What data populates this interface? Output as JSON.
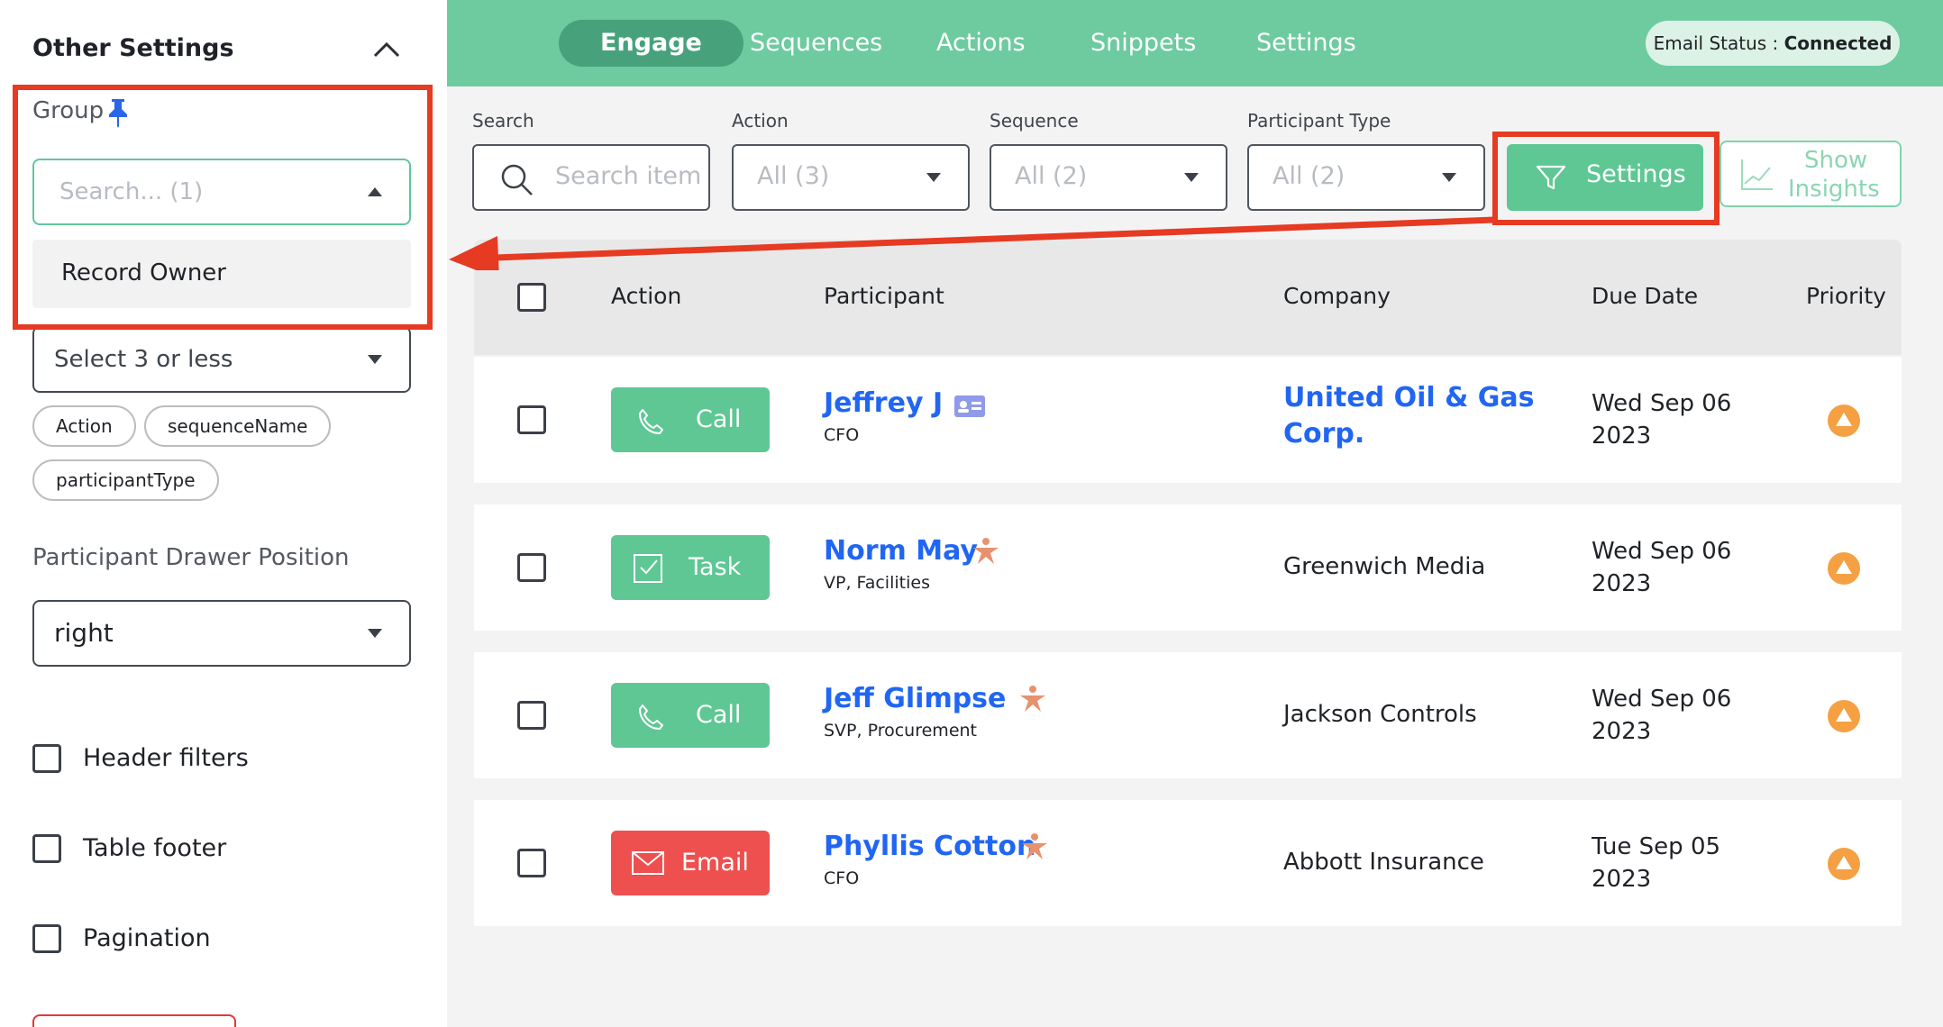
{
  "left_panel": {
    "title": "Other Settings",
    "group": {
      "label": "Group",
      "search_placeholder": "Search... (1)",
      "option": "Record Owner",
      "select_placeholder": "Select 3 or less",
      "chips": [
        "Action",
        "sequenceName",
        "participantType"
      ]
    },
    "drawer": {
      "label": "Participant Drawer Position",
      "value": "right"
    },
    "checkboxes": [
      "Header filters",
      "Table footer",
      "Pagination"
    ]
  },
  "nav": {
    "tabs": [
      "Engage",
      "Sequences",
      "Actions",
      "Snippets",
      "Settings"
    ],
    "active_tab": "Engage",
    "email_status_label": "Email Status",
    "email_status_value": "Connected"
  },
  "filters": {
    "search_label": "Search",
    "search_placeholder": "Search items",
    "action_label": "Action",
    "action_value": "All (3)",
    "sequence_label": "Sequence",
    "sequence_value": "All (2)",
    "participant_label": "Participant Type",
    "participant_value": "All (2)",
    "settings_button": "Settings",
    "insights_line1": "Show",
    "insights_line2": "Insights"
  },
  "table": {
    "headers": [
      "Action",
      "Participant",
      "Company",
      "Due Date",
      "Priority"
    ],
    "rows": [
      {
        "action": "Call",
        "action_icon": "phone-icon",
        "name": "Jeffrey J",
        "title": "CFO",
        "badge": "contact-card-icon",
        "company": "United Oil & Gas Corp.",
        "company_link": true,
        "due_line1": "Wed Sep 06",
        "due_line2": "2023",
        "priority": "high"
      },
      {
        "action": "Task",
        "action_icon": "task-checkbox-icon",
        "name": "Norm May",
        "title": "VP, Facilities",
        "badge": "star-person-icon",
        "company": "Greenwich Media",
        "company_link": false,
        "due_line1": "Wed Sep 06",
        "due_line2": "2023",
        "priority": "high"
      },
      {
        "action": "Call",
        "action_icon": "phone-icon",
        "name": "Jeff Glimpse",
        "title": "SVP, Procurement",
        "badge": "star-person-icon",
        "company": "Jackson Controls",
        "company_link": false,
        "due_line1": "Wed Sep 06",
        "due_line2": "2023",
        "priority": "high"
      },
      {
        "action": "Email",
        "action_icon": "envelope-icon",
        "name": "Phyllis Cotton",
        "title": "CFO",
        "badge": "star-person-icon",
        "company": "Abbott Insurance",
        "company_link": false,
        "due_line1": "Tue Sep 05",
        "due_line2": "2023",
        "priority": "high"
      }
    ]
  },
  "colors": {
    "brand_green": "#6dcb9f",
    "active_tab": "#47a27b",
    "button_green": "#5ec794",
    "email_red": "#ee4f4f",
    "link_blue": "#2166f3",
    "priority_orange": "#f5a043",
    "annotation_red": "#e63a22"
  }
}
